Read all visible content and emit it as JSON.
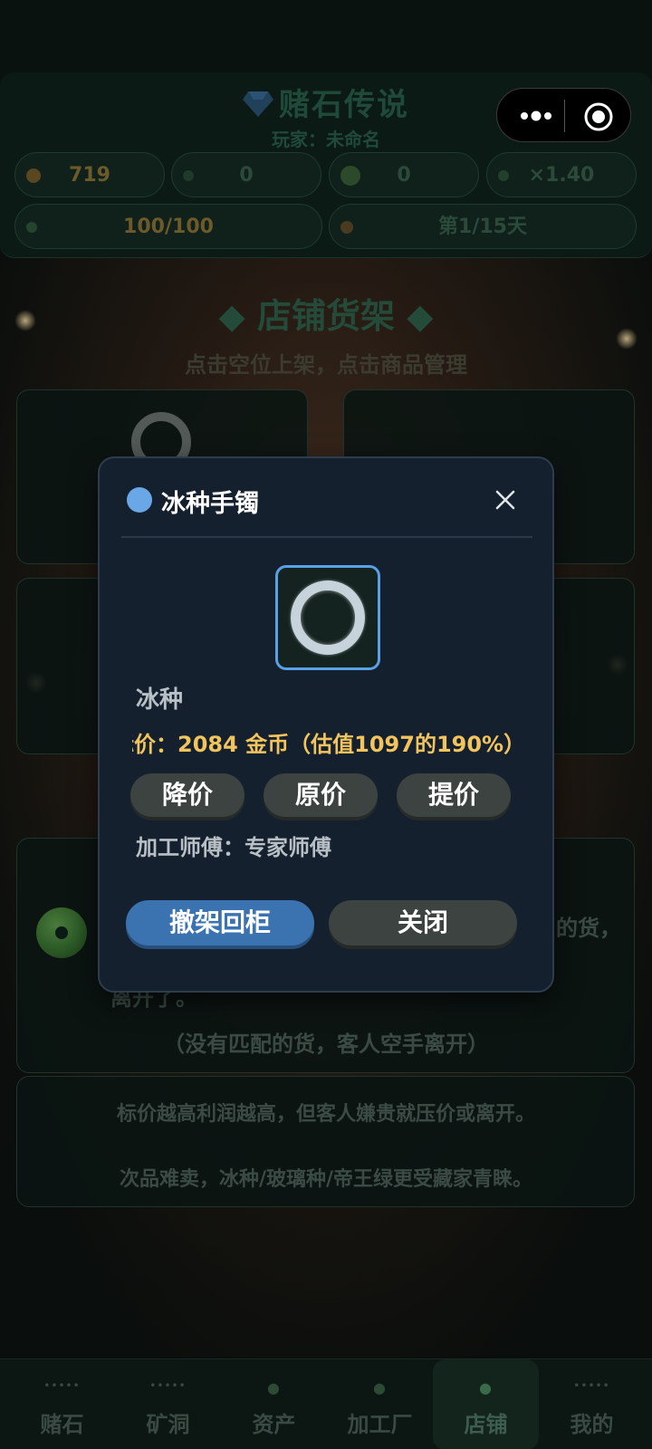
{
  "header": {
    "game_title": "赌石传说",
    "player_line": "玩家：未命名"
  },
  "stats": {
    "gold": "719",
    "stone_count": "0",
    "jade_count": "0",
    "multiplier": "×1.40",
    "stamina": "100/100",
    "day": "第1/15天"
  },
  "colors": {
    "modal_bg": "#15202e",
    "accent_blue": "#5aa0e6",
    "price_gold": "#f2c45e",
    "grade_dot": "#6aa7e6"
  },
  "shop": {
    "title": "◆ 店铺货架 ◆",
    "subtitle": "点击空位上架，点击商品管理",
    "customer_fragment_end": "的货，",
    "customer_fragment_line2": "离开了。",
    "customer_none": "（没有匹配的货，客人空手离开）",
    "tip1": "标价越高利润越高，但客人嫌贵就压价或离开。",
    "tip2": "次品难卖，冰种/玻璃种/帝王绿更受藏家青睐。"
  },
  "modal": {
    "title": "冰种手镯",
    "close_icon": "close-icon",
    "grade": "冰种",
    "price_text": "标价：2084 金币（估值1097的190%）",
    "btn_lower": "降价",
    "btn_original": "原价",
    "btn_raise": "提价",
    "master": "加工师傅：专家师傅",
    "btn_remove": "撤架回柜",
    "btn_close": "关闭"
  },
  "nav": {
    "items": [
      {
        "label": "赌石",
        "icon": "dots-icon"
      },
      {
        "label": "矿洞",
        "icon": "dots-icon"
      },
      {
        "label": "资产",
        "icon": "jade-icon"
      },
      {
        "label": "加工厂",
        "icon": "jade-icon"
      },
      {
        "label": "店铺",
        "icon": "jade-icon"
      },
      {
        "label": "我的",
        "icon": "dots-icon"
      }
    ],
    "active_index": 4
  }
}
